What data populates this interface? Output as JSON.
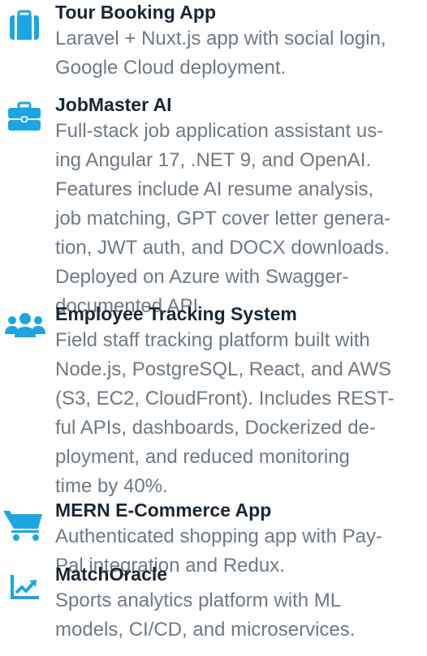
{
  "accent_color": "#1aa6e5",
  "projects": [
    {
      "icon": "suitcase-icon",
      "title": "Tour Booking App",
      "description_lines": [
        "Laravel + Nuxt.js app with social login,",
        "Google Cloud deployment."
      ]
    },
    {
      "icon": "briefcase-icon",
      "title": "JobMaster AI",
      "description_lines": [
        "Full-stack job application assistant us-",
        "ing Angular 17, .NET 9, and OpenAI.",
        "Features include AI resume analysis,",
        "job matching, GPT cover letter genera-",
        "tion, JWT auth, and DOCX downloads.",
        "Deployed on Azure with Swagger-",
        "documented API."
      ]
    },
    {
      "icon": "users-icon",
      "title": "Employee Tracking System",
      "description_lines": [
        "Field staff tracking platform built with",
        "Node.js, PostgreSQL, React, and AWS",
        "(S3, EC2, CloudFront). Includes REST-",
        "ful APIs, dashboards, Dockerized de-",
        "ployment, and reduced monitoring",
        "time by 40%."
      ]
    },
    {
      "icon": "shopping-cart-icon",
      "title": "MERN E-Commerce App",
      "description_lines": [
        "Authenticated shopping app with Pay-",
        "Pal integration and Redux."
      ]
    },
    {
      "icon": "chart-line-icon",
      "title": "MatchOracle",
      "description_lines": [
        "Sports analytics platform with ML",
        "models, CI/CD, and microservices."
      ]
    }
  ]
}
